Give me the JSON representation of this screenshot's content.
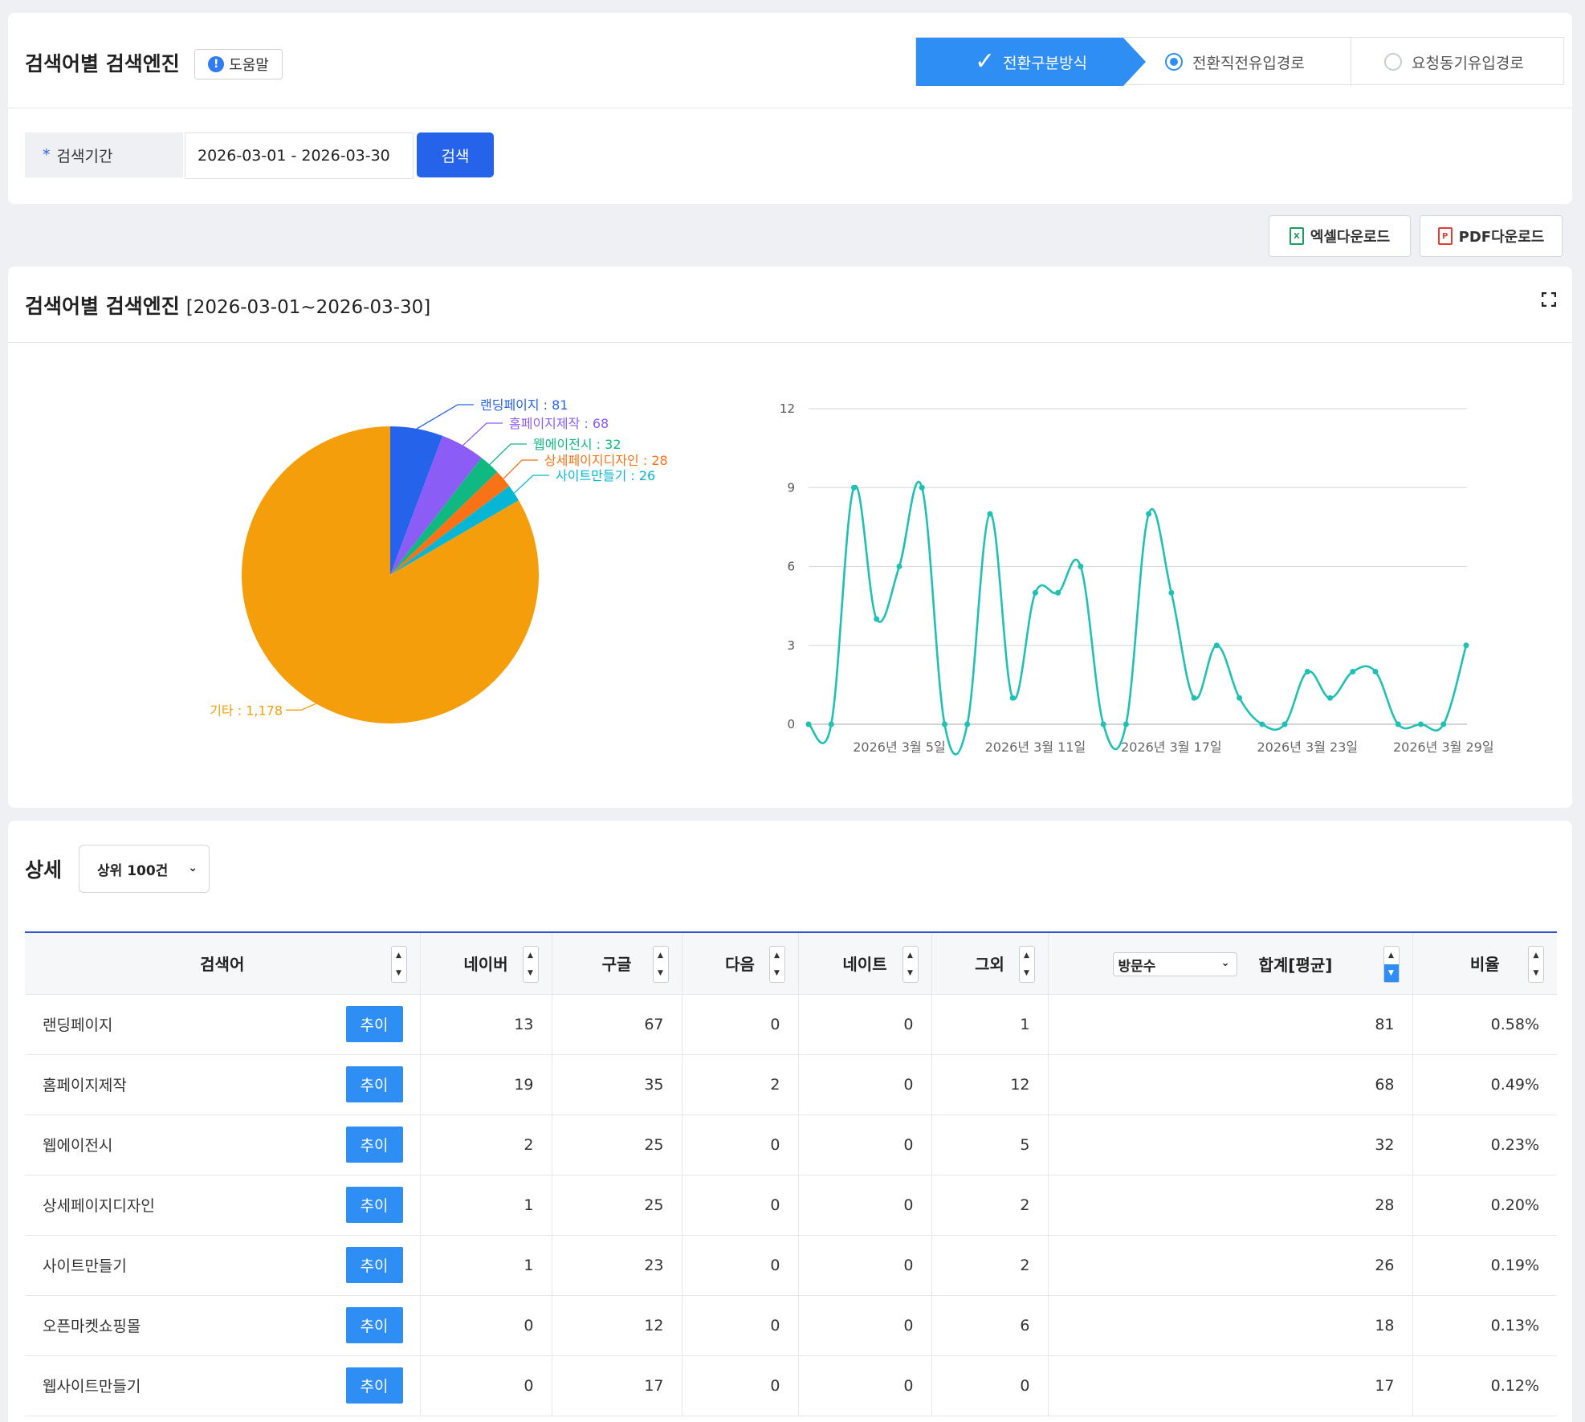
{
  "header": {
    "title": "검색어별 검색엔진",
    "help_label": "도움말",
    "modes": [
      {
        "label": "전환구분방식",
        "active": true
      },
      {
        "label": "전환직전유입경로",
        "selected": true
      },
      {
        "label": "요청동기유입경로",
        "selected": false
      }
    ]
  },
  "search": {
    "period_label": "검색기간",
    "date_range": "2026-03-01 - 2026-03-30",
    "button_label": "검색"
  },
  "downloads": {
    "excel_label": "엑셀다운로드",
    "pdf_label": "PDF다운로드"
  },
  "chart_section": {
    "title": "검색어별 검색엔진",
    "range": "[2026-03-01~2026-03-30]"
  },
  "chart_data": [
    {
      "type": "pie",
      "slices": [
        {
          "label": "랜딩페이지",
          "value": 81,
          "color": "#2563eb",
          "display": "랜딩페이지 : 81"
        },
        {
          "label": "홈페이지제작",
          "value": 68,
          "color": "#8b5cf6",
          "display": "홈페이지제작 : 68"
        },
        {
          "label": "웹에이전시",
          "value": 32,
          "color": "#10b981",
          "display": "웹에이전시 : 32"
        },
        {
          "label": "상세페이지디자인",
          "value": 28,
          "color": "#f97316",
          "display": "상세페이지디자인 : 28"
        },
        {
          "label": "사이트만들기",
          "value": 26,
          "color": "#06b6d4",
          "display": "사이트만들기 : 26"
        },
        {
          "label": "기타",
          "value": 1178,
          "color": "#f59e0b",
          "display": "기타 : 1,178"
        }
      ]
    },
    {
      "type": "line",
      "color": "#20c0b4",
      "ylim": [
        0,
        12
      ],
      "yticks": [
        0,
        3,
        6,
        9,
        12
      ],
      "xtick_labels": [
        "2026년 3월 5일",
        "2026년 3월 11일",
        "2026년 3월 17일",
        "2026년 3월 23일",
        "2026년 3월 29일"
      ],
      "xtick_days": [
        5,
        11,
        17,
        23,
        29
      ],
      "x_days": [
        1,
        2,
        3,
        4,
        5,
        6,
        7,
        8,
        9,
        10,
        11,
        12,
        13,
        14,
        15,
        16,
        17,
        18,
        19,
        20,
        21,
        22,
        23,
        24,
        25,
        26,
        27,
        28,
        29,
        30
      ],
      "values": [
        0,
        0,
        9,
        4,
        6,
        9,
        0,
        0,
        8,
        1,
        5,
        5,
        6,
        0,
        0,
        8,
        5,
        1,
        3,
        1,
        0,
        0,
        2,
        1,
        2,
        2,
        0,
        0,
        0,
        3
      ]
    }
  ],
  "detail": {
    "title": "상세",
    "top_select": "상위 100건",
    "metric_select": "방문수",
    "columns": {
      "keyword": "검색어",
      "naver": "네이버",
      "google": "구글",
      "daum": "다음",
      "nate": "네이트",
      "other": "그외",
      "sum": "합계[평균]",
      "ratio": "비율"
    },
    "trend_label": "추이",
    "rows": [
      {
        "keyword": "랜딩페이지",
        "naver": "13",
        "google": "67",
        "daum": "0",
        "nate": "0",
        "other": "1",
        "sum": "81",
        "ratio": "0.58%"
      },
      {
        "keyword": "홈페이지제작",
        "naver": "19",
        "google": "35",
        "daum": "2",
        "nate": "0",
        "other": "12",
        "sum": "68",
        "ratio": "0.49%"
      },
      {
        "keyword": "웹에이전시",
        "naver": "2",
        "google": "25",
        "daum": "0",
        "nate": "0",
        "other": "5",
        "sum": "32",
        "ratio": "0.23%"
      },
      {
        "keyword": "상세페이지디자인",
        "naver": "1",
        "google": "25",
        "daum": "0",
        "nate": "0",
        "other": "2",
        "sum": "28",
        "ratio": "0.20%"
      },
      {
        "keyword": "사이트만들기",
        "naver": "1",
        "google": "23",
        "daum": "0",
        "nate": "0",
        "other": "2",
        "sum": "26",
        "ratio": "0.19%"
      },
      {
        "keyword": "오픈마켓쇼핑몰",
        "naver": "0",
        "google": "12",
        "daum": "0",
        "nate": "0",
        "other": "6",
        "sum": "18",
        "ratio": "0.13%"
      },
      {
        "keyword": "웹사이트만들기",
        "naver": "0",
        "google": "17",
        "daum": "0",
        "nate": "0",
        "other": "0",
        "sum": "17",
        "ratio": "0.12%"
      }
    ]
  }
}
